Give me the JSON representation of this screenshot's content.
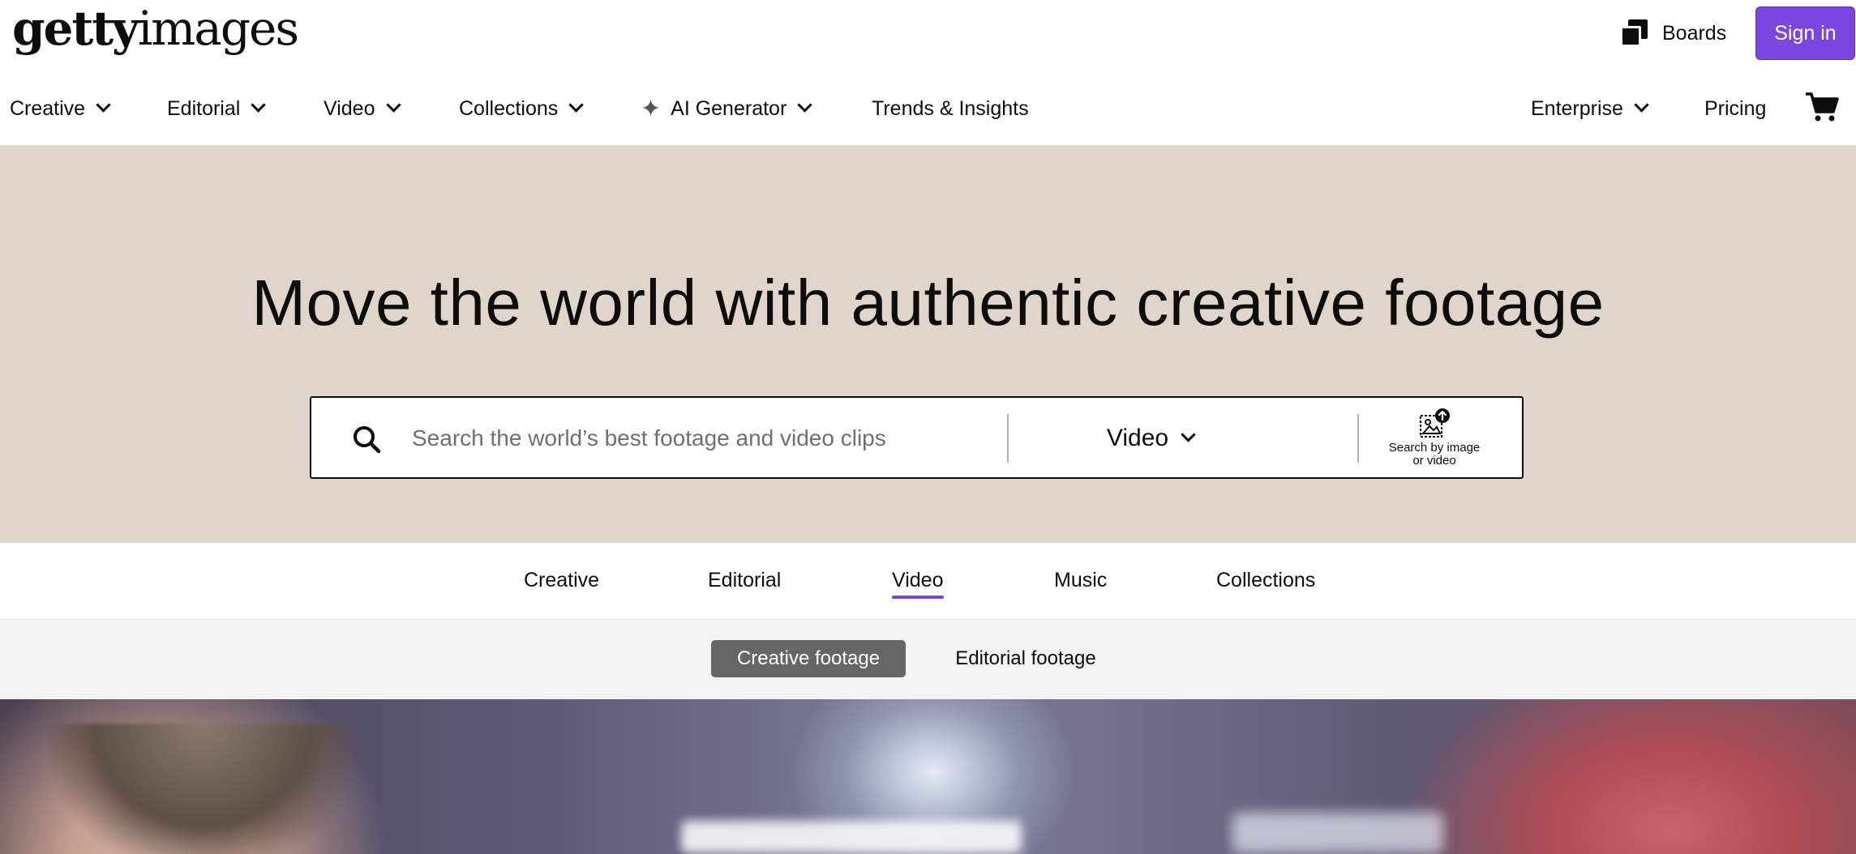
{
  "header": {
    "logo": {
      "bold": "getty",
      "light": "images"
    },
    "boards_label": "Boards",
    "signin_label": "Sign in"
  },
  "nav": {
    "items": [
      {
        "label": "Creative",
        "has_dropdown": true
      },
      {
        "label": "Editorial",
        "has_dropdown": true
      },
      {
        "label": "Video",
        "has_dropdown": true
      },
      {
        "label": "Collections",
        "has_dropdown": true
      },
      {
        "label": "AI Generator",
        "has_dropdown": true,
        "icon": "sparkle-icon"
      },
      {
        "label": "Trends & Insights",
        "has_dropdown": false
      }
    ],
    "right_items": [
      {
        "label": "Enterprise",
        "has_dropdown": true
      },
      {
        "label": "Pricing",
        "has_dropdown": false
      }
    ],
    "cart_icon": "cart-icon"
  },
  "hero": {
    "title": "Move the world with authentic creative footage",
    "search": {
      "placeholder": "Search the world’s best footage and video clips",
      "value": "",
      "type_selected": "Video",
      "by_image_line1": "Search by image",
      "by_image_line2": "or video"
    }
  },
  "tabs": {
    "items": [
      {
        "label": "Creative"
      },
      {
        "label": "Editorial"
      },
      {
        "label": "Video",
        "active": true
      },
      {
        "label": "Music"
      },
      {
        "label": "Collections"
      }
    ]
  },
  "subtabs": {
    "active": "Creative footage",
    "inactive": "Editorial footage"
  },
  "colors": {
    "accent": "#7b46df",
    "hero_bg": "#e0d5ca",
    "subtab_active_bg": "#666666"
  }
}
